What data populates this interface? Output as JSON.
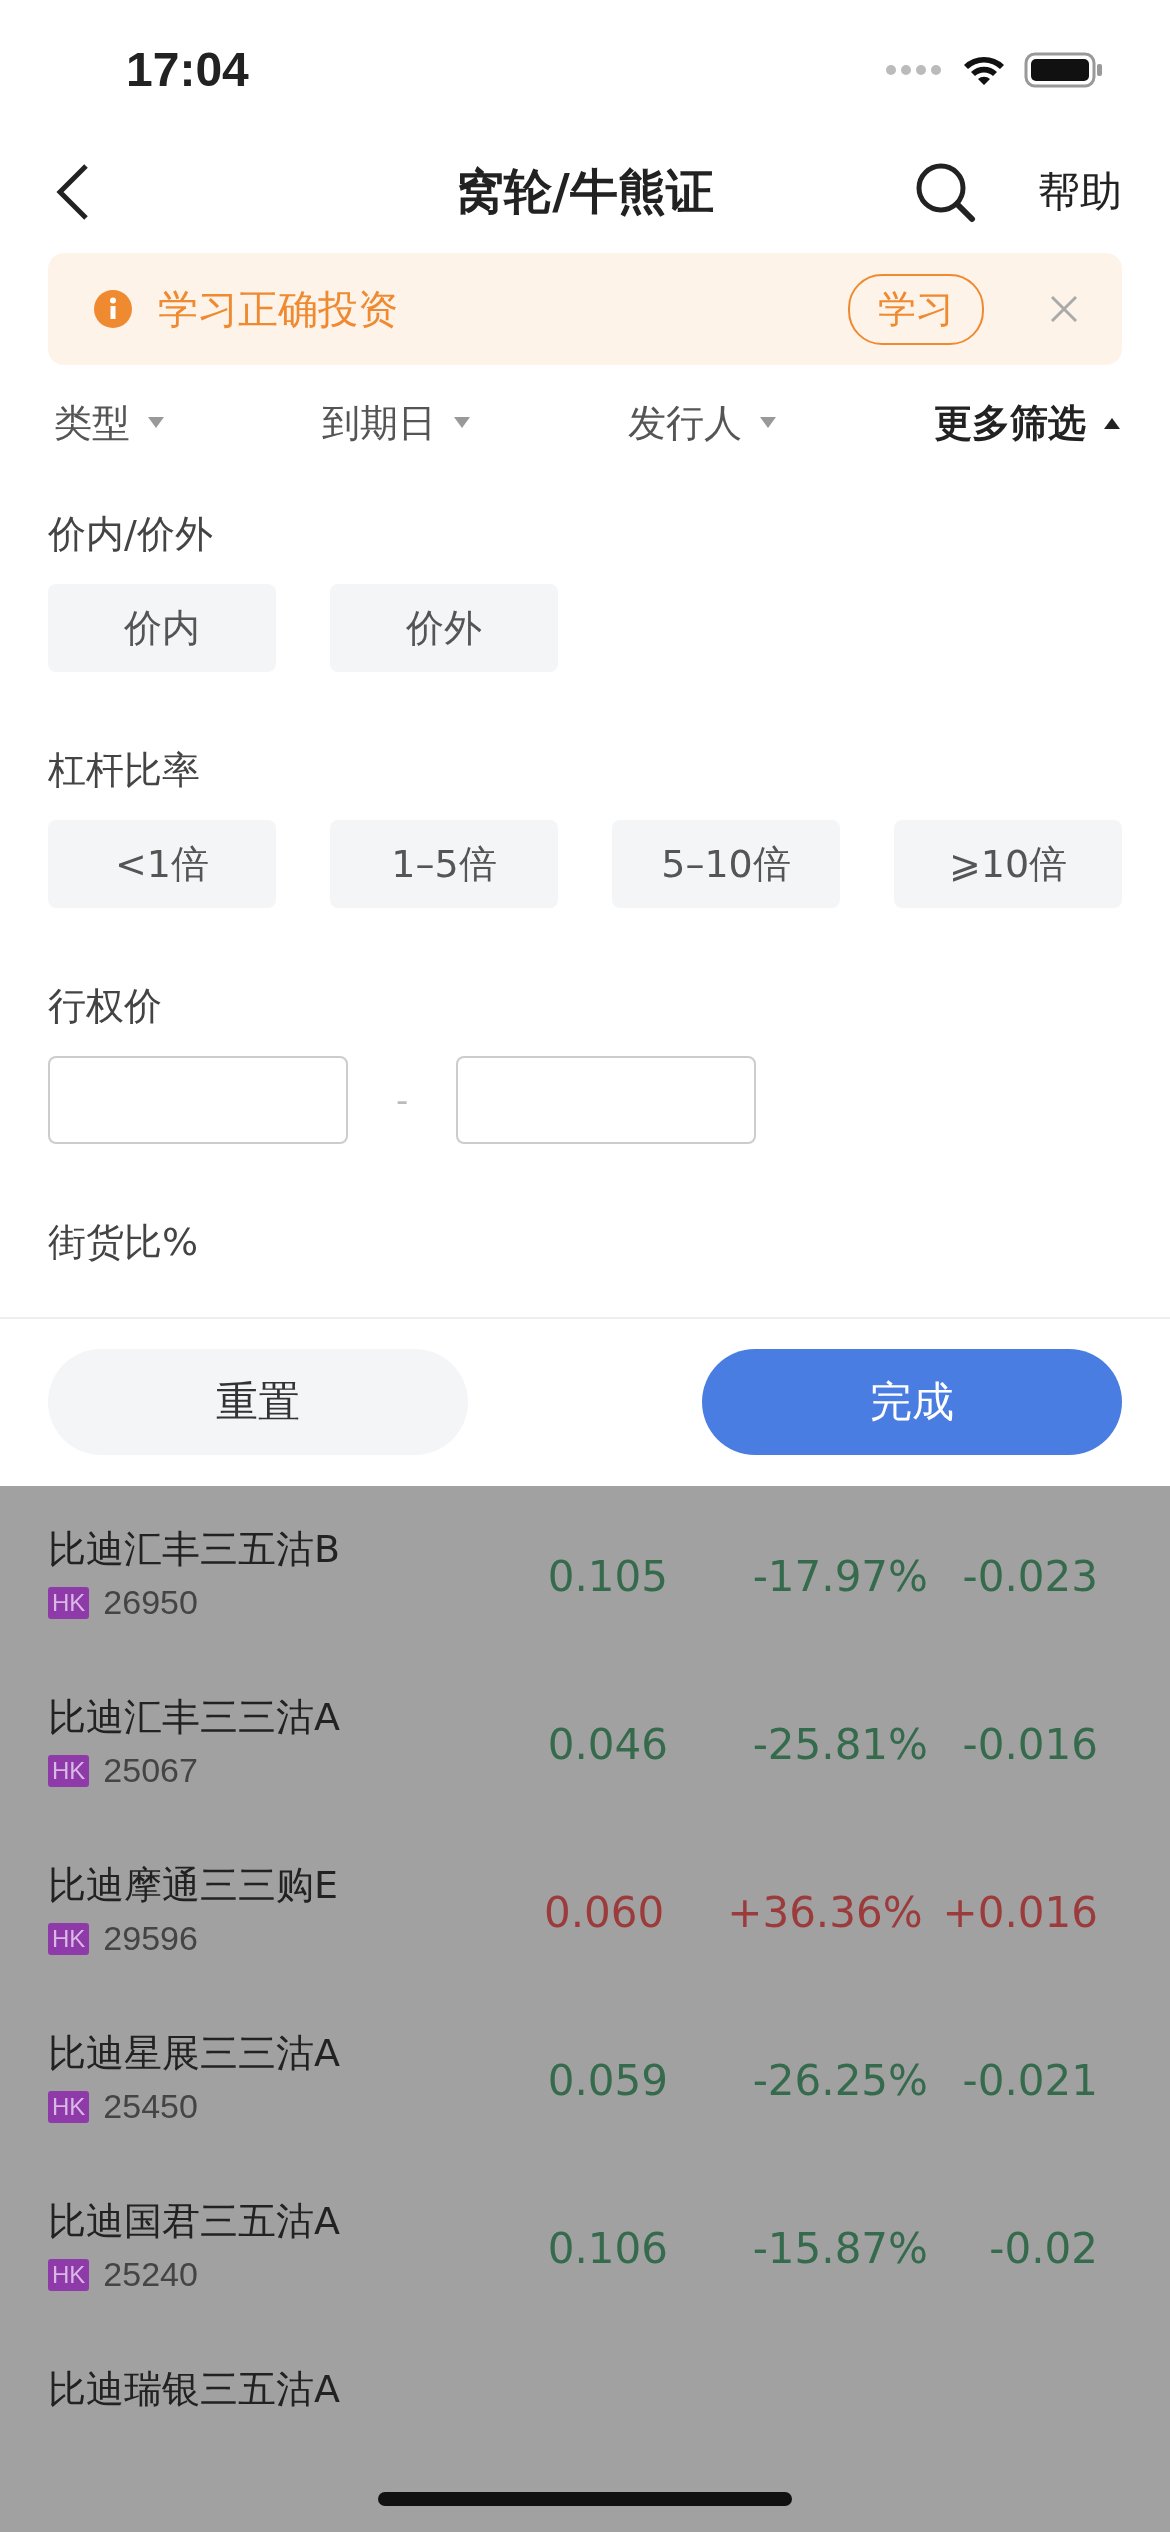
{
  "status_bar": {
    "time": "17:04"
  },
  "header": {
    "title": "窝轮/牛熊证",
    "help": "帮助"
  },
  "banner": {
    "text": "学习正确投资",
    "button": "学习"
  },
  "filters": [
    {
      "label": "类型",
      "expanded": false
    },
    {
      "label": "到期日",
      "expanded": false
    },
    {
      "label": "发行人",
      "expanded": false
    },
    {
      "label": "更多筛选",
      "expanded": true
    }
  ],
  "sections": [
    {
      "title": "价内/价外",
      "kind": "chips",
      "options": [
        "价内",
        "价外"
      ]
    },
    {
      "title": "杠杆比率",
      "kind": "chips",
      "options": [
        "<1倍",
        "1–5倍",
        "5–10倍",
        "⩾10倍"
      ]
    },
    {
      "title": "行权价",
      "kind": "range",
      "separator": "-"
    },
    {
      "title": "街货比%",
      "kind": "heading"
    }
  ],
  "actions": {
    "reset": "重置",
    "done": "完成"
  },
  "rows": [
    {
      "name": "比迪汇丰三五沽B",
      "market": "HK",
      "code": "26950",
      "price": "0.105",
      "change_pct": "-17.97%",
      "change": "-0.023",
      "color": "#356b4c"
    },
    {
      "name": "比迪汇丰三三沽A",
      "market": "HK",
      "code": "25067",
      "price": "0.046",
      "change_pct": "-25.81%",
      "change": "-0.016",
      "color": "#356b4c"
    },
    {
      "name": "比迪摩通三三购E",
      "market": "HK",
      "code": "29596",
      "price": "0.060",
      "change_pct": "+36.36%",
      "change": "+0.016",
      "color": "#9b3b3b"
    },
    {
      "name": "比迪星展三三沽A",
      "market": "HK",
      "code": "25450",
      "price": "0.059",
      "change_pct": "-26.25%",
      "change": "-0.021",
      "color": "#356b4c"
    },
    {
      "name": "比迪国君三五沽A",
      "market": "HK",
      "code": "25240",
      "price": "0.106",
      "change_pct": "-15.87%",
      "change": "-0.02",
      "color": "#356b4c"
    },
    {
      "name": "比迪瑞银三五沽A"
    }
  ]
}
